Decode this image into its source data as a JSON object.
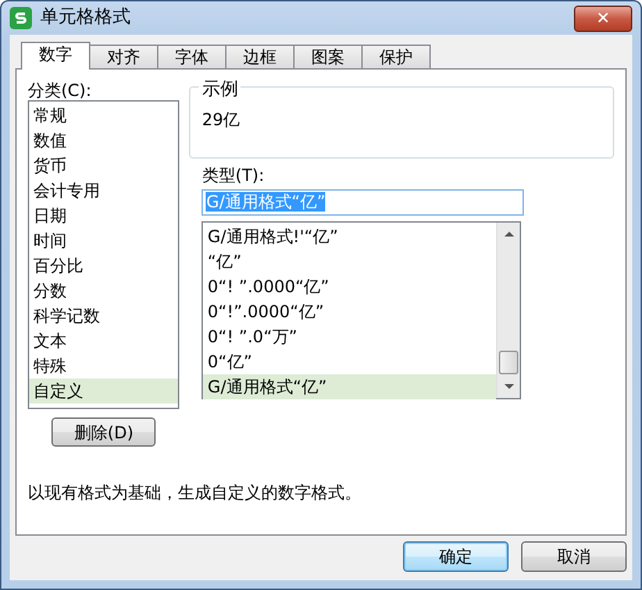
{
  "window": {
    "title": "单元格格式",
    "close": "✕"
  },
  "tabs": [
    {
      "label": "数字",
      "selected": true
    },
    {
      "label": "对齐",
      "selected": false
    },
    {
      "label": "字体",
      "selected": false
    },
    {
      "label": "边框",
      "selected": false
    },
    {
      "label": "图案",
      "selected": false
    },
    {
      "label": "保护",
      "selected": false
    }
  ],
  "category": {
    "label": "分类(C):",
    "items": [
      {
        "label": "常规",
        "selected": false
      },
      {
        "label": "数值",
        "selected": false
      },
      {
        "label": "货币",
        "selected": false
      },
      {
        "label": "会计专用",
        "selected": false
      },
      {
        "label": "日期",
        "selected": false
      },
      {
        "label": "时间",
        "selected": false
      },
      {
        "label": "百分比",
        "selected": false
      },
      {
        "label": "分数",
        "selected": false
      },
      {
        "label": "科学记数",
        "selected": false
      },
      {
        "label": "文本",
        "selected": false
      },
      {
        "label": "特殊",
        "selected": false
      },
      {
        "label": "自定义",
        "selected": true
      }
    ]
  },
  "delete_button": "删除(D)",
  "sample": {
    "label": "示例",
    "value": "29亿"
  },
  "type": {
    "label": "类型(T):",
    "value": "G/通用格式“亿”",
    "items": [
      {
        "label": "G/通用格式!'“亿”",
        "selected": false
      },
      {
        "label": "“亿”",
        "selected": false
      },
      {
        "label": "0“! ”.0000“亿”",
        "selected": false
      },
      {
        "label": "0“!”.0000“亿”",
        "selected": false
      },
      {
        "label": "0“! ”.0“万”",
        "selected": false
      },
      {
        "label": "0“亿”",
        "selected": false
      },
      {
        "label": "G/通用格式“亿”",
        "selected": true
      }
    ]
  },
  "description": "以现有格式为基础，生成自定义的数字格式。",
  "buttons": [
    {
      "label": "确定",
      "kind": "default"
    },
    {
      "label": "取消",
      "kind": "normal"
    }
  ]
}
